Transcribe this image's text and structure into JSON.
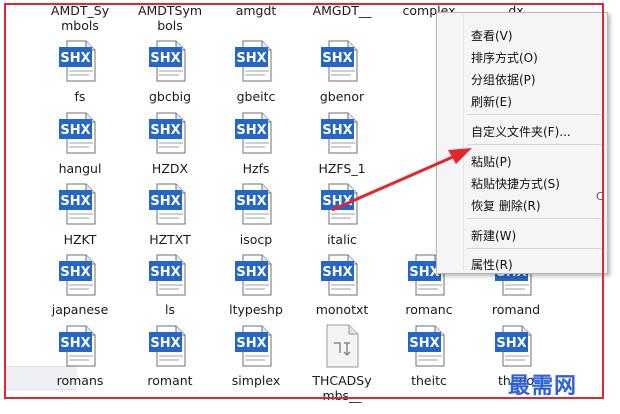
{
  "top_labels": [
    {
      "l1": "AMDT_Sy",
      "l2": "mbols"
    },
    {
      "l1": "AMDTSym",
      "l2": "bols"
    },
    {
      "l1": "amgdt",
      "l2": ""
    },
    {
      "l1": "AMGDT__",
      "l2": ""
    },
    {
      "l1": "complex",
      "l2": ""
    },
    {
      "l1": "dx",
      "l2": ""
    }
  ],
  "rows": [
    [
      {
        "name": "fs",
        "icon": "shx"
      },
      {
        "name": "gbcbig",
        "icon": "shx"
      },
      {
        "name": "gbeitc",
        "icon": "shx"
      },
      {
        "name": "gbenor",
        "icon": "shx"
      }
    ],
    [
      {
        "name": "hangul",
        "icon": "shx"
      },
      {
        "name": "HZDX",
        "icon": "shx"
      },
      {
        "name": "Hzfs",
        "icon": "shx"
      },
      {
        "name": "HZFS_1",
        "icon": "shx"
      }
    ],
    [
      {
        "name": "HZKT",
        "icon": "shx"
      },
      {
        "name": "HZTXT",
        "icon": "shx"
      },
      {
        "name": "isocp",
        "icon": "shx"
      },
      {
        "name": "italic",
        "icon": "shx"
      }
    ],
    [
      {
        "name": "japanese",
        "icon": "shx"
      },
      {
        "name": "ls",
        "icon": "shx"
      },
      {
        "name": "ltypeshp",
        "icon": "shx"
      },
      {
        "name": "monotxt",
        "icon": "shx"
      },
      {
        "name": "romanc",
        "icon": "shx"
      },
      {
        "name": "romand",
        "icon": "shx"
      }
    ],
    [
      {
        "name": "romans",
        "icon": "shx"
      },
      {
        "name": "romant",
        "icon": "shx"
      },
      {
        "name": "simplex",
        "icon": "shx"
      },
      {
        "name": "THCADSy",
        "name2": "mbs__",
        "icon": "generic"
      },
      {
        "name": "theitc",
        "icon": "shx"
      },
      {
        "name": "theno",
        "icon": "shx"
      }
    ]
  ],
  "icon_badge_text": "SHX",
  "context_menu": [
    {
      "label": "查看(V)"
    },
    {
      "label": "排序方式(O)"
    },
    {
      "label": "分组依据(P)"
    },
    {
      "label": "刷新(E)"
    },
    {
      "label": "自定义文件夹(F)..."
    },
    {
      "label": "粘贴(P)"
    },
    {
      "label": "粘贴快捷方式(S)"
    },
    {
      "label": "恢复 删除(R)"
    },
    {
      "label": "新建(W)"
    },
    {
      "label": "属性(R)"
    }
  ],
  "edge_char": "C",
  "watermark": "最需网",
  "colors": {
    "badge": "#2466c9",
    "frame": "#e0282e",
    "arrow": "#e3262c",
    "watermark": "#2d62d8"
  }
}
